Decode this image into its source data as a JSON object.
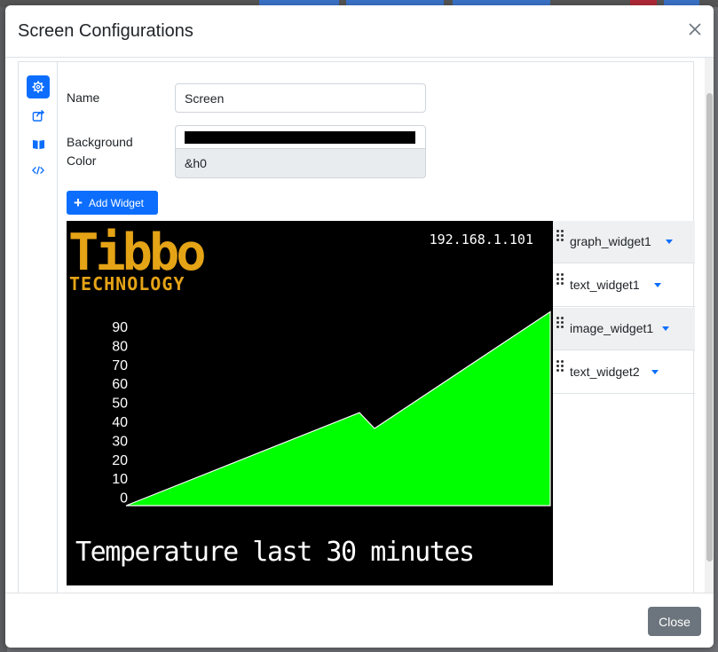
{
  "modal": {
    "title": "Screen Configurations",
    "close_label": "Close"
  },
  "sidebar": {
    "items": [
      {
        "icon": "gear-icon",
        "active": true
      },
      {
        "icon": "share-icon",
        "active": false
      },
      {
        "icon": "book-icon",
        "active": false
      },
      {
        "icon": "code-icon",
        "active": false
      }
    ]
  },
  "form": {
    "name_label": "Name",
    "name_value": "Screen",
    "bg_label_line1": "Background",
    "bg_label_line2": "Color",
    "bg_color_value": "#000000",
    "bg_color_hex": "&h0",
    "add_widget_label": "Add Widget"
  },
  "screen": {
    "logo_line1": "Tibbo",
    "logo_line2": "TECHNOLOGY",
    "ip_address": "192.168.1.101",
    "caption": "Temperature last 30 minutes",
    "colors": {
      "background": "#000000",
      "logo": "#e5a316",
      "fill": "#00ff00",
      "text": "#ffffff"
    }
  },
  "chart_data": {
    "type": "area",
    "x": [
      0,
      1,
      2,
      3
    ],
    "values": [
      0,
      47,
      39,
      98
    ],
    "y_ticks": [
      "90",
      "80",
      "70",
      "60",
      "50",
      "40",
      "30",
      "20",
      "10",
      "0"
    ],
    "ylim": [
      0,
      100
    ]
  },
  "widgets": [
    {
      "name": "graph_widget1",
      "shaded": true
    },
    {
      "name": "text_widget1",
      "shaded": false
    },
    {
      "name": "image_widget1",
      "shaded": true
    },
    {
      "name": "text_widget2",
      "shaded": false
    }
  ]
}
